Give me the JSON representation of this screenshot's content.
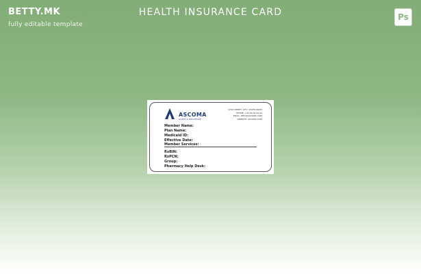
{
  "header": {
    "brand": "BETTY.MK",
    "tagline": "fully editable template",
    "title": "HEALTH INSURANCE CARD",
    "ps_label": "Ps"
  },
  "card": {
    "company": "ASCOMA",
    "company_sub": "ALPES & PROVENCE",
    "address_lines": [
      "1234 STREET, CITY, STATE 00000",
      "PHONE: +00 00 00 00 00",
      "EMAIL: INFO@ASCOMA.COM",
      "WEBSITE: ASCOMA.COM"
    ],
    "fields_top": [
      "Member Name:",
      "Plan Name:",
      "Medicaid ID:",
      "Effective Date:",
      "Member Services:"
    ],
    "fields_bottom": [
      "RxBIN:",
      "RxPCN:",
      "Group:",
      "Pharmacy Help Desk:"
    ]
  },
  "colors": {
    "background_top": "#82ad77",
    "logo_blue": "#1f3c77"
  },
  "icons": [
    "photoshop-icon",
    "ascoma-logo-icon"
  ]
}
